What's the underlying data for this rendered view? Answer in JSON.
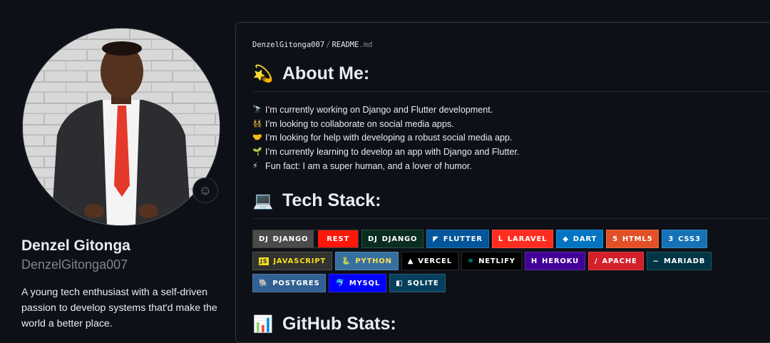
{
  "profile": {
    "display_name": "Denzel Gitonga",
    "username": "DenzelGitonga007",
    "bio": "A young tech enthusiast with a self-driven passion to develop systems that'd make the world a better place.",
    "status_icon": "smiley-icon"
  },
  "readme": {
    "breadcrumb_user": "DenzelGitonga007",
    "breadcrumb_sep": "/",
    "breadcrumb_file": "README",
    "breadcrumb_ext": ".md",
    "about": {
      "emoji": "💫",
      "title": "About Me:",
      "items": [
        {
          "icon": "🔭",
          "text": "I’m currently working on Django and Flutter development."
        },
        {
          "icon": "👯",
          "text": "I’m looking to collaborate on social media apps."
        },
        {
          "icon": "🤝",
          "text": "I’m looking for help with developing a robust social media app."
        },
        {
          "icon": "🌱",
          "text": "I’m currently learning to develop an app with Django and Flutter."
        },
        {
          "icon": "⚡",
          "text": "Fun fact: I am a super human, and a lover of humor."
        }
      ]
    },
    "tech": {
      "emoji": "💻",
      "title": "Tech Stack:"
    },
    "stats": {
      "emoji": "📊",
      "title": "GitHub Stats:"
    },
    "badges": {
      "django_rest_left": "DJANGO",
      "django_rest_right": "REST",
      "django": "DJANGO",
      "flutter": "FLUTTER",
      "laravel": "LARAVEL",
      "dart": "DART",
      "html5": "HTML5",
      "css3": "CSS3",
      "javascript": "JAVASCRIPT",
      "python": "PYTHON",
      "vercel": "VERCEL",
      "netlify": "NETLIFY",
      "heroku": "HEROKU",
      "apache": "APACHE",
      "mariadb": "MARIADB",
      "postgres": "POSTGRES",
      "mysql": "MYSQL",
      "sqlite": "SQLITE"
    }
  },
  "colors": {
    "background": "#0d1117",
    "border": "#30363d",
    "muted": "#7d8590",
    "django": "#092e20",
    "rest": "#ff1709",
    "flutter": "#02569b",
    "laravel": "#ff2d20",
    "dart": "#0175c2",
    "html5": "#e34f26",
    "css3": "#1572b6",
    "python": "#3670a0",
    "heroku": "#430098",
    "apache": "#d42029",
    "mariadb": "#003545",
    "postgres": "#316192",
    "mysql": "#00f",
    "sqlite": "#07405e"
  }
}
